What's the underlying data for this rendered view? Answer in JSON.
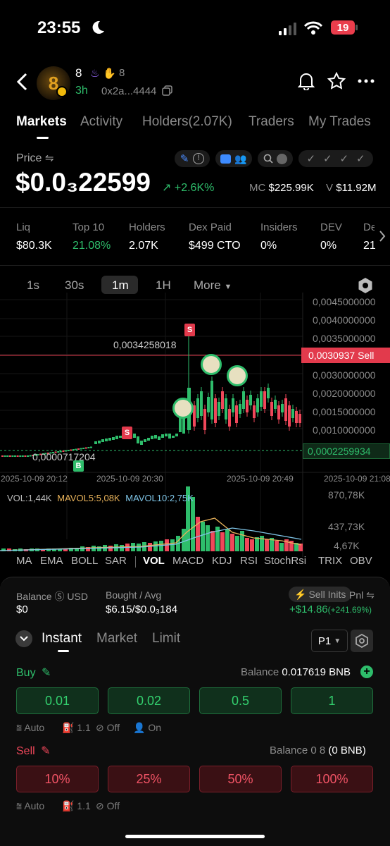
{
  "status_bar": {
    "time": "23:55",
    "battery": "19"
  },
  "token": {
    "name": "8",
    "reaction_count": "8",
    "age": "3h",
    "address": "0x2a...4444"
  },
  "tabs": [
    "Markets",
    "Activity",
    "Holders(2.07K)",
    "Traders",
    "My Trades"
  ],
  "price": {
    "label": "Price",
    "value": "$0.0₃22599",
    "change": "+2.6K%",
    "mc_label": "MC",
    "mc_value": "$225.99K",
    "v_label": "V",
    "v_value": "$11.92M"
  },
  "stats": [
    {
      "label": "Liq",
      "value": "$80.3K"
    },
    {
      "label": "Top 10",
      "value": "21.08%"
    },
    {
      "label": "Holders",
      "value": "2.07K"
    },
    {
      "label": "Dex Paid",
      "value": "$499 CTO"
    },
    {
      "label": "Insiders",
      "value": "0%"
    },
    {
      "label": "DEV",
      "value": "0%"
    },
    {
      "label": "De",
      "value": "21"
    }
  ],
  "timeframes": [
    "1s",
    "30s",
    "1m",
    "1H",
    "More"
  ],
  "chart_data": {
    "type": "candlestick",
    "ylim": [
      0,
      0.0045
    ],
    "y_ticks": [
      "0,0045000000",
      "0,0040000000",
      "0,0035000000",
      "0,0030000000",
      "0,0020000000",
      "0,0015000000",
      "0,0010000000",
      "0,0002259934"
    ],
    "x_ticks": [
      "2025-10-09 20:12",
      "2025-10-09 20:30",
      "2025-10-09 20:49",
      "2025-10-09 21:08"
    ],
    "high_label": "0,0034258018",
    "low_label": "0,0000717204",
    "sell_price_label": "0,0030937 Sell",
    "current_price": 0.00022599,
    "volume": {
      "vol": "VOL:1,44K",
      "mavol5": "MAVOL5:5,08K",
      "mavol10": "MAVOL10:2,75K",
      "y_ticks": [
        "870,78K",
        "437,73K",
        "4,67K"
      ]
    }
  },
  "indicators": [
    "MA",
    "EMA",
    "BOLL",
    "SAR",
    "VOL",
    "MACD",
    "KDJ",
    "RSI",
    "StochRsi",
    "TRIX",
    "OBV"
  ],
  "position": {
    "balance_label": "Balance",
    "balance_unit": "USD",
    "balance_value": "$0",
    "bought_label": "Bought / Avg",
    "bought_value": "$6.15/$0.0₃184",
    "sell_inits": "Sell Inits",
    "pnl_label": "Pnl",
    "pnl_value": "+$14.86",
    "pnl_pct": "(+241.69%)"
  },
  "order_tabs": [
    "Instant",
    "Market",
    "Limit"
  ],
  "preset": "P1",
  "buy": {
    "label": "Buy",
    "balance_label": "Balance",
    "balance_value": "0.017619 BNB",
    "amounts": [
      "0.01",
      "0.02",
      "0.5",
      "1"
    ],
    "opts": [
      "Auto",
      "1.1",
      "Off",
      "On"
    ]
  },
  "sell": {
    "label": "Sell",
    "balance_label": "Balance 0 8",
    "balance_value": "(0 BNB)",
    "amounts": [
      "10%",
      "25%",
      "50%",
      "100%"
    ],
    "opts": [
      "Auto",
      "1.1",
      "Off"
    ]
  },
  "colors": {
    "green": "#2ebd6b",
    "red": "#f0475a",
    "bg": "#000000"
  }
}
